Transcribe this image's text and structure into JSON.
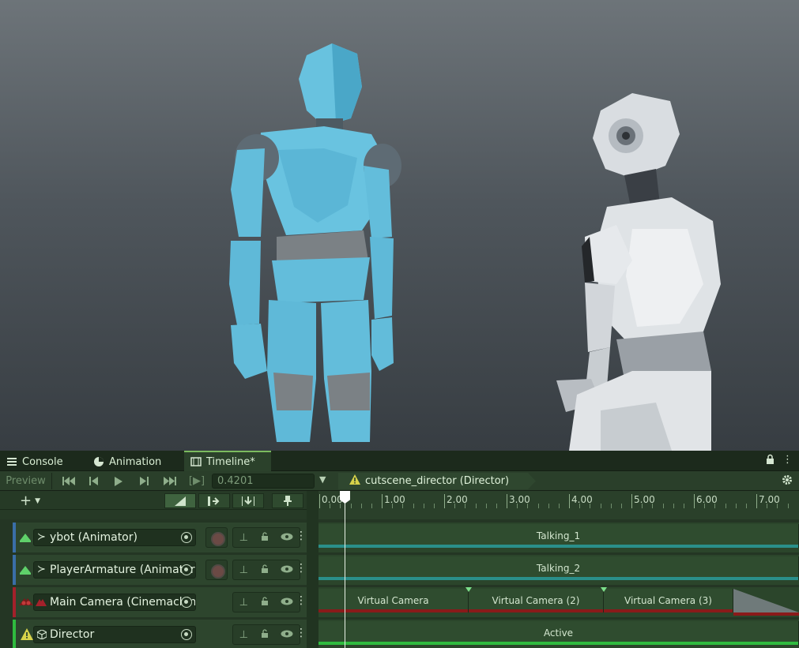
{
  "tabs": [
    {
      "label": "Console",
      "icon": "console-icon"
    },
    {
      "label": "Animation",
      "icon": "animation-icon"
    },
    {
      "label": "Timeline*",
      "icon": "timeline-icon"
    }
  ],
  "toolbar": {
    "preview_label": "Preview",
    "time_value": "0.4201",
    "director_label": "cutscene_director (Director)"
  },
  "ruler": {
    "labels": [
      "0.00",
      "1.00",
      "2.00",
      "3.00",
      "4.00",
      "5.00",
      "6.00",
      "7.00"
    ]
  },
  "tracks": [
    {
      "name": "ybot (Animator)",
      "type": "animation-track",
      "clips": [
        {
          "label": "Talking_1"
        }
      ]
    },
    {
      "name": "PlayerArmature (Animator)",
      "type": "animation-track",
      "clips": [
        {
          "label": "Talking_2"
        }
      ]
    },
    {
      "name": "Main Camera (Cinemachine Brain)",
      "type": "cinemachine-track",
      "clips": [
        {
          "label": "Virtual Camera"
        },
        {
          "label": "Virtual Camera (2)"
        },
        {
          "label": "Virtual Camera (3)"
        }
      ]
    },
    {
      "name": "Director",
      "type": "activation-track",
      "clips": [
        {
          "label": "Active"
        }
      ]
    }
  ],
  "colors": {
    "accent_green": "#7bbb5e",
    "animation_track": "#3a6ea8",
    "camera_track": "#a3212b",
    "activation_track": "#2fbb3f",
    "anim_clip_bar": "#2a8f8a",
    "camera_clip_bar": "#8a1a1a"
  }
}
